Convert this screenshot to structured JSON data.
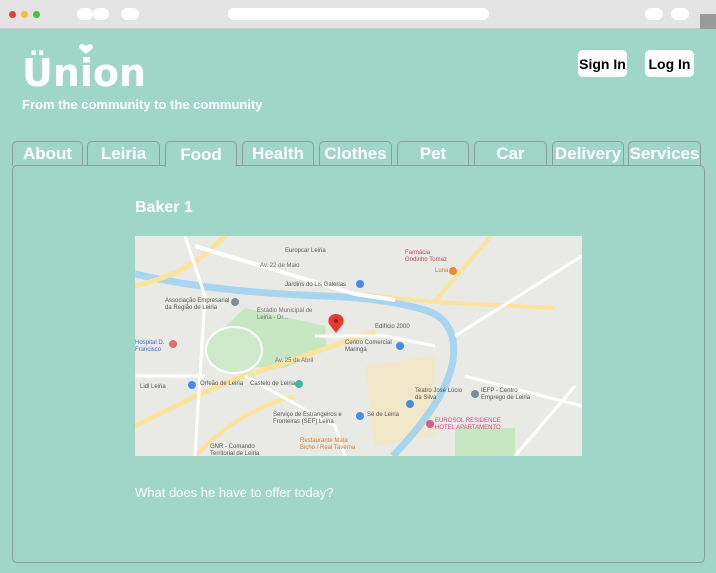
{
  "browser": {
    "colors": {
      "close": "#e4403a",
      "minimize": "#f2be32",
      "maximize": "#46c23d"
    }
  },
  "brand": {
    "logo_text": "Ünion",
    "tagline": "From the community to the community",
    "color": "#ffffff"
  },
  "auth": {
    "sign_in_label": "Sign In",
    "log_in_label": "Log In"
  },
  "tabs": [
    {
      "label": "About",
      "active": false
    },
    {
      "label": "Leiria",
      "active": false
    },
    {
      "label": "Food",
      "active": true
    },
    {
      "label": "Health",
      "active": false
    },
    {
      "label": "Clothes",
      "active": false
    },
    {
      "label": "Pet",
      "active": false
    },
    {
      "label": "Car",
      "active": false
    },
    {
      "label": "Delivery",
      "active": false
    },
    {
      "label": "Services",
      "active": false
    }
  ],
  "content": {
    "title": "Baker 1",
    "question": "What does he have to offer today?"
  },
  "map": {
    "labels": [
      "Europcar Leiria",
      "Farmácia Godinho Tomaz",
      "Luna",
      "Av. 22 de Maio",
      "Jardins do Lis Galerias",
      "Associação Empresarial da Região de Leiria",
      "Estádio Municipal de Leiria - Dr...",
      "Edifício 2000",
      "Centro Comercial Maringá",
      "Hospital D. Francisco",
      "Av. 25 de Abril",
      "Lidl Leiria",
      "Orfeão de Leiria",
      "Castelo de Leiria",
      "Teatro José Lúcio da Silva",
      "IEFP - Centro Emprego de Leiria",
      "Sé de Leiria",
      "Serviço de Estrangeiros e Fronteiras (SEF) Leiria",
      "EUROSOL RESIDENCE HOTEL APARTAMENTO",
      "GNR - Comando Territorial de Leiria",
      "Restaurante Mata Bicho / Real Taverna"
    ],
    "colors": {
      "water": "#a7d4ef",
      "park": "#c7e6c2",
      "road": "#fbe39a",
      "pin": "#e53b30"
    }
  }
}
